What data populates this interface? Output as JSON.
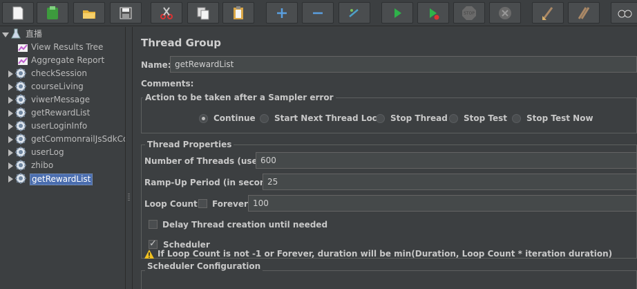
{
  "toolbar": {
    "buttons": [
      {
        "name": "new-icon"
      },
      {
        "name": "templates-icon"
      },
      {
        "name": "open-icon"
      },
      {
        "name": "save-icon"
      },
      {
        "name": "cut-icon"
      },
      {
        "name": "copy-icon"
      },
      {
        "name": "paste-icon"
      },
      {
        "name": "expand-icon"
      },
      {
        "name": "collapse-icon"
      },
      {
        "name": "toggle-icon"
      },
      {
        "name": "start-icon"
      },
      {
        "name": "start-no-pauses-icon"
      },
      {
        "name": "stop-icon"
      },
      {
        "name": "shutdown-icon"
      },
      {
        "name": "clear-icon"
      },
      {
        "name": "clear-all-icon"
      },
      {
        "name": "search-icon"
      }
    ],
    "stop_text": "STOP"
  },
  "tree": {
    "root": "直播",
    "items": [
      {
        "label": "View Results Tree",
        "type": "listener"
      },
      {
        "label": "Aggregate Report",
        "type": "listener"
      },
      {
        "label": "checkSession",
        "type": "thread-group"
      },
      {
        "label": "courseLiving",
        "type": "thread-group"
      },
      {
        "label": "viwerMessage",
        "type": "thread-group"
      },
      {
        "label": "getRewardList",
        "type": "thread-group"
      },
      {
        "label": "userLoginInfo",
        "type": "thread-group"
      },
      {
        "label": "getCommonrailJsSdkCo",
        "type": "thread-group"
      },
      {
        "label": "userLog",
        "type": "thread-group"
      },
      {
        "label": "zhibo",
        "type": "thread-group"
      },
      {
        "label": "getRewardList",
        "type": "thread-group",
        "selected": true
      }
    ]
  },
  "panel": {
    "title": "Thread Group",
    "name_label": "Name:",
    "name_value": "getRewardList",
    "comments_label": "Comments:",
    "sampler_error": {
      "legend": "Action to be taken after a Sampler error",
      "options": [
        "Continue",
        "Start Next Thread Loop",
        "Stop Thread",
        "Stop Test",
        "Stop Test Now"
      ],
      "selected": "Continue"
    },
    "thread_props": {
      "legend": "Thread Properties",
      "threads_label": "Number of Threads (users):",
      "threads_value": "600",
      "rampup_label": "Ramp-Up Period (in seconds):",
      "rampup_value": "25",
      "loop_label": "Loop Count:",
      "forever_label": "Forever",
      "forever_checked": false,
      "loop_value": "100",
      "delay_label": "Delay Thread creation until needed",
      "delay_checked": false,
      "scheduler_label": "Scheduler",
      "scheduler_checked": true
    },
    "scheduler_config": {
      "legend": "Scheduler Configuration",
      "warning": "If Loop Count is not -1 or Forever, duration will be min(Duration, Loop Count * iteration duration)"
    }
  },
  "colors": {
    "background": "#3c3f41",
    "selection": "#4b6eaf",
    "input_bg": "#45494a",
    "text": "#bbbbbb"
  }
}
